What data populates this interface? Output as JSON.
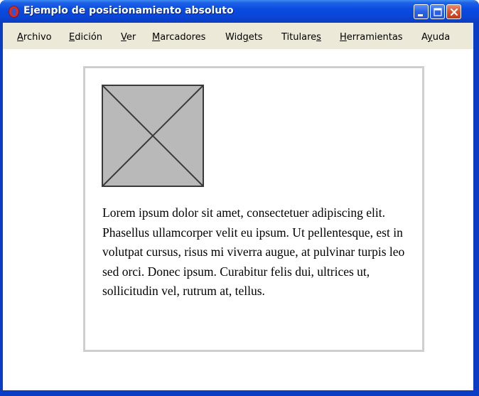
{
  "window": {
    "title": "Ejemplo de posicionamiento absoluto",
    "app_icon": "opera-icon",
    "controls": [
      "minimize-icon",
      "maximize-icon",
      "close-icon"
    ]
  },
  "menubar": {
    "items": [
      {
        "before": "",
        "accel": "A",
        "after": "rchivo"
      },
      {
        "before": "",
        "accel": "E",
        "after": "dición"
      },
      {
        "before": "",
        "accel": "V",
        "after": "er"
      },
      {
        "before": "",
        "accel": "M",
        "after": "arcadores"
      },
      {
        "before": "Wid",
        "accel": "g",
        "after": "ets"
      },
      {
        "before": "Titulare",
        "accel": "s",
        "after": ""
      },
      {
        "before": "",
        "accel": "H",
        "after": "erramientas"
      },
      {
        "before": "A",
        "accel": "y",
        "after": "uda"
      }
    ]
  },
  "content": {
    "image_icon": "image-placeholder-icon",
    "paragraph": "Lorem ipsum dolor sit amet, consectetuer adipiscing elit. Phasellus ullamcorper velit eu ipsum. Ut pellentesque, est in volutpat cursus, risus mi viverra augue, at pulvinar turpis leo sed orci. Donec ipsum. Curabitur felis dui, ultrices ut, sollicitudin vel, rutrum at, tellus."
  },
  "colors": {
    "titlebar": "#0a46d8",
    "menubar": "#ece9d8",
    "box_border": "#cfcfcf",
    "placeholder_fill": "#b9b9b9"
  }
}
